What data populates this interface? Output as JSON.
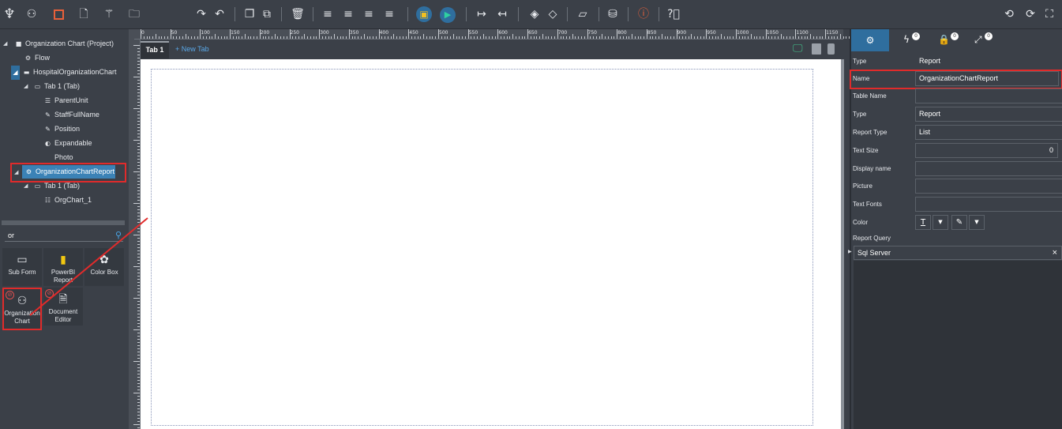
{
  "toolbar": {
    "left_icons": [
      "octopus-logo-icon",
      "user-icon",
      "square-icon",
      "file-icon",
      "magic-wand-icon",
      "folder-icon"
    ],
    "right_icons": [
      "history-icon",
      "refresh-icon",
      "fullscreen-icon"
    ]
  },
  "tree": {
    "project": "Organization Chart (Project)",
    "flow": "Flow",
    "form": "HospitalOrganizationChart",
    "tab1": "Tab 1 (Tab)",
    "fields": [
      "ParentUnit",
      "StaffFullName",
      "Position",
      "Expandable",
      "Photo"
    ],
    "report": "OrganizationChartReport",
    "report_tab": "Tab 1 (Tab)",
    "report_item": "OrgChart_1"
  },
  "search": {
    "value": "or"
  },
  "components": [
    {
      "label": "Sub Form"
    },
    {
      "label": "PowerBI Report"
    },
    {
      "label": "Color Box"
    },
    {
      "label": "Organization Chart"
    },
    {
      "label": "Document Editor"
    }
  ],
  "canvas": {
    "tab_label": "Tab 1",
    "new_tab": "+ New Tab",
    "ruler_top": [
      "0",
      "50",
      "100",
      "150",
      "200",
      "250",
      "300",
      "350",
      "400",
      "450",
      "500",
      "550",
      "600",
      "650",
      "700",
      "750",
      "800",
      "850",
      "900",
      "950",
      "1000",
      "1050",
      "1100",
      "1150"
    ]
  },
  "properties": {
    "tab_badges": [
      "0",
      "0",
      "0"
    ],
    "rows": [
      {
        "label": "Type",
        "value": "Report"
      },
      {
        "label": "Name",
        "value": "OrganizationChartReport"
      },
      {
        "label": "Table Name",
        "value": ""
      },
      {
        "label": "Type",
        "value": "Report"
      },
      {
        "label": "Report Type",
        "value": "List"
      },
      {
        "label": "Text Size",
        "value": "0"
      },
      {
        "label": "Display name",
        "value": ""
      },
      {
        "label": "Picture",
        "value": ""
      },
      {
        "label": "Text Fonts",
        "value": ""
      }
    ],
    "color_label": "Color",
    "report_query_label": "Report Query",
    "sql_label": "Sql Server",
    "sql_close": "×"
  },
  "colors": {
    "accent": "#2f6e9e",
    "highlight": "#e02b2b",
    "selection": "#3b82b6",
    "link": "#5aa8e8"
  }
}
